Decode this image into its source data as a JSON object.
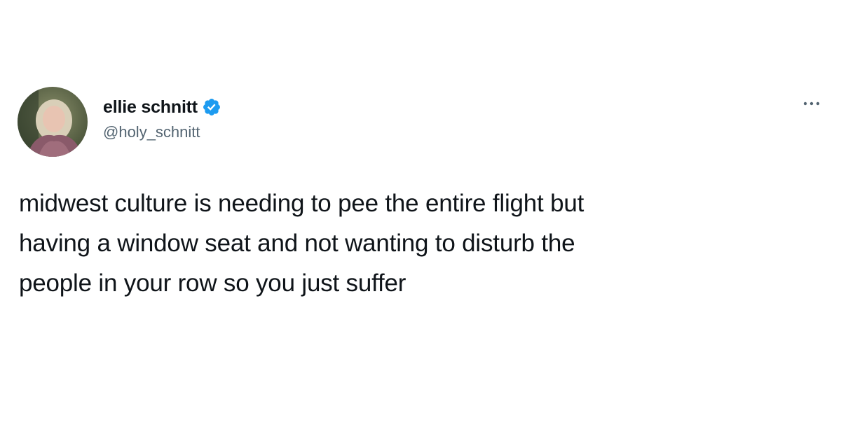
{
  "tweet": {
    "author": {
      "display_name": "ellie schnitt",
      "handle": "@holy_schnitt",
      "verified": true,
      "avatar_icon": "profile-photo"
    },
    "more_icon": "more-options-icon",
    "text": "midwest culture is needing to pee the entire flight but\nhaving a window seat and not wanting to disturb the\npeople in your row so you just suffer"
  },
  "colors": {
    "verified_badge": "#1d9bf0",
    "handle_text": "#536471",
    "body_text": "#0f1419"
  }
}
